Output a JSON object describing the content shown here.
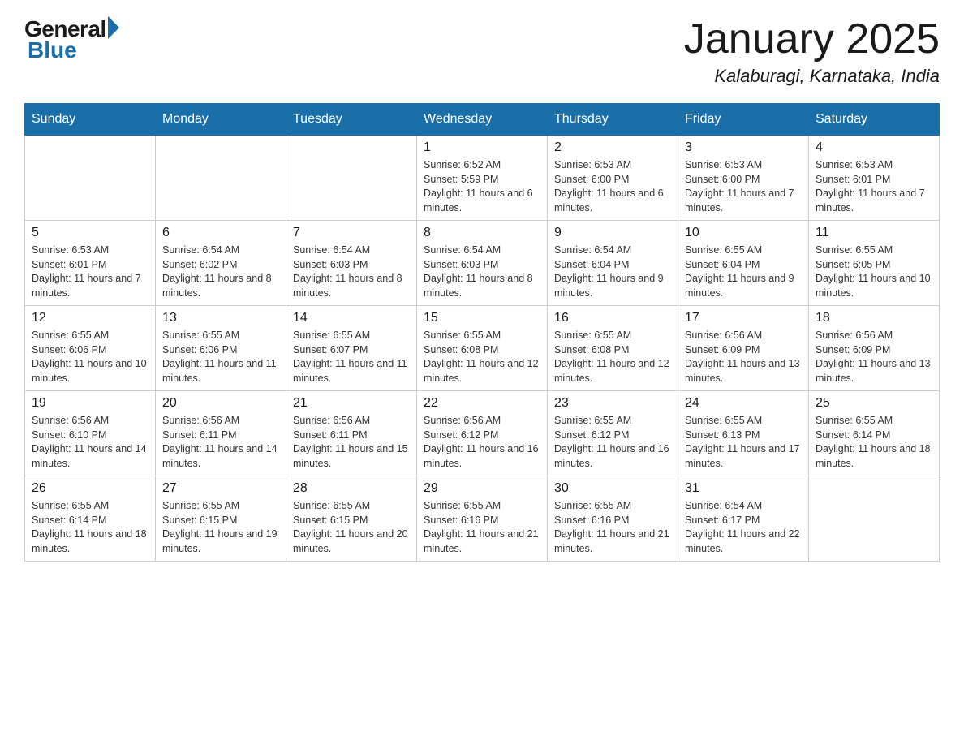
{
  "header": {
    "logo_general": "General",
    "logo_blue": "Blue",
    "month_title": "January 2025",
    "location": "Kalaburagi, Karnataka, India"
  },
  "weekdays": [
    "Sunday",
    "Monday",
    "Tuesday",
    "Wednesday",
    "Thursday",
    "Friday",
    "Saturday"
  ],
  "weeks": [
    [
      {
        "day": "",
        "info": ""
      },
      {
        "day": "",
        "info": ""
      },
      {
        "day": "",
        "info": ""
      },
      {
        "day": "1",
        "info": "Sunrise: 6:52 AM\nSunset: 5:59 PM\nDaylight: 11 hours and 6 minutes."
      },
      {
        "day": "2",
        "info": "Sunrise: 6:53 AM\nSunset: 6:00 PM\nDaylight: 11 hours and 6 minutes."
      },
      {
        "day": "3",
        "info": "Sunrise: 6:53 AM\nSunset: 6:00 PM\nDaylight: 11 hours and 7 minutes."
      },
      {
        "day": "4",
        "info": "Sunrise: 6:53 AM\nSunset: 6:01 PM\nDaylight: 11 hours and 7 minutes."
      }
    ],
    [
      {
        "day": "5",
        "info": "Sunrise: 6:53 AM\nSunset: 6:01 PM\nDaylight: 11 hours and 7 minutes."
      },
      {
        "day": "6",
        "info": "Sunrise: 6:54 AM\nSunset: 6:02 PM\nDaylight: 11 hours and 8 minutes."
      },
      {
        "day": "7",
        "info": "Sunrise: 6:54 AM\nSunset: 6:03 PM\nDaylight: 11 hours and 8 minutes."
      },
      {
        "day": "8",
        "info": "Sunrise: 6:54 AM\nSunset: 6:03 PM\nDaylight: 11 hours and 8 minutes."
      },
      {
        "day": "9",
        "info": "Sunrise: 6:54 AM\nSunset: 6:04 PM\nDaylight: 11 hours and 9 minutes."
      },
      {
        "day": "10",
        "info": "Sunrise: 6:55 AM\nSunset: 6:04 PM\nDaylight: 11 hours and 9 minutes."
      },
      {
        "day": "11",
        "info": "Sunrise: 6:55 AM\nSunset: 6:05 PM\nDaylight: 11 hours and 10 minutes."
      }
    ],
    [
      {
        "day": "12",
        "info": "Sunrise: 6:55 AM\nSunset: 6:06 PM\nDaylight: 11 hours and 10 minutes."
      },
      {
        "day": "13",
        "info": "Sunrise: 6:55 AM\nSunset: 6:06 PM\nDaylight: 11 hours and 11 minutes."
      },
      {
        "day": "14",
        "info": "Sunrise: 6:55 AM\nSunset: 6:07 PM\nDaylight: 11 hours and 11 minutes."
      },
      {
        "day": "15",
        "info": "Sunrise: 6:55 AM\nSunset: 6:08 PM\nDaylight: 11 hours and 12 minutes."
      },
      {
        "day": "16",
        "info": "Sunrise: 6:55 AM\nSunset: 6:08 PM\nDaylight: 11 hours and 12 minutes."
      },
      {
        "day": "17",
        "info": "Sunrise: 6:56 AM\nSunset: 6:09 PM\nDaylight: 11 hours and 13 minutes."
      },
      {
        "day": "18",
        "info": "Sunrise: 6:56 AM\nSunset: 6:09 PM\nDaylight: 11 hours and 13 minutes."
      }
    ],
    [
      {
        "day": "19",
        "info": "Sunrise: 6:56 AM\nSunset: 6:10 PM\nDaylight: 11 hours and 14 minutes."
      },
      {
        "day": "20",
        "info": "Sunrise: 6:56 AM\nSunset: 6:11 PM\nDaylight: 11 hours and 14 minutes."
      },
      {
        "day": "21",
        "info": "Sunrise: 6:56 AM\nSunset: 6:11 PM\nDaylight: 11 hours and 15 minutes."
      },
      {
        "day": "22",
        "info": "Sunrise: 6:56 AM\nSunset: 6:12 PM\nDaylight: 11 hours and 16 minutes."
      },
      {
        "day": "23",
        "info": "Sunrise: 6:55 AM\nSunset: 6:12 PM\nDaylight: 11 hours and 16 minutes."
      },
      {
        "day": "24",
        "info": "Sunrise: 6:55 AM\nSunset: 6:13 PM\nDaylight: 11 hours and 17 minutes."
      },
      {
        "day": "25",
        "info": "Sunrise: 6:55 AM\nSunset: 6:14 PM\nDaylight: 11 hours and 18 minutes."
      }
    ],
    [
      {
        "day": "26",
        "info": "Sunrise: 6:55 AM\nSunset: 6:14 PM\nDaylight: 11 hours and 18 minutes."
      },
      {
        "day": "27",
        "info": "Sunrise: 6:55 AM\nSunset: 6:15 PM\nDaylight: 11 hours and 19 minutes."
      },
      {
        "day": "28",
        "info": "Sunrise: 6:55 AM\nSunset: 6:15 PM\nDaylight: 11 hours and 20 minutes."
      },
      {
        "day": "29",
        "info": "Sunrise: 6:55 AM\nSunset: 6:16 PM\nDaylight: 11 hours and 21 minutes."
      },
      {
        "day": "30",
        "info": "Sunrise: 6:55 AM\nSunset: 6:16 PM\nDaylight: 11 hours and 21 minutes."
      },
      {
        "day": "31",
        "info": "Sunrise: 6:54 AM\nSunset: 6:17 PM\nDaylight: 11 hours and 22 minutes."
      },
      {
        "day": "",
        "info": ""
      }
    ]
  ]
}
